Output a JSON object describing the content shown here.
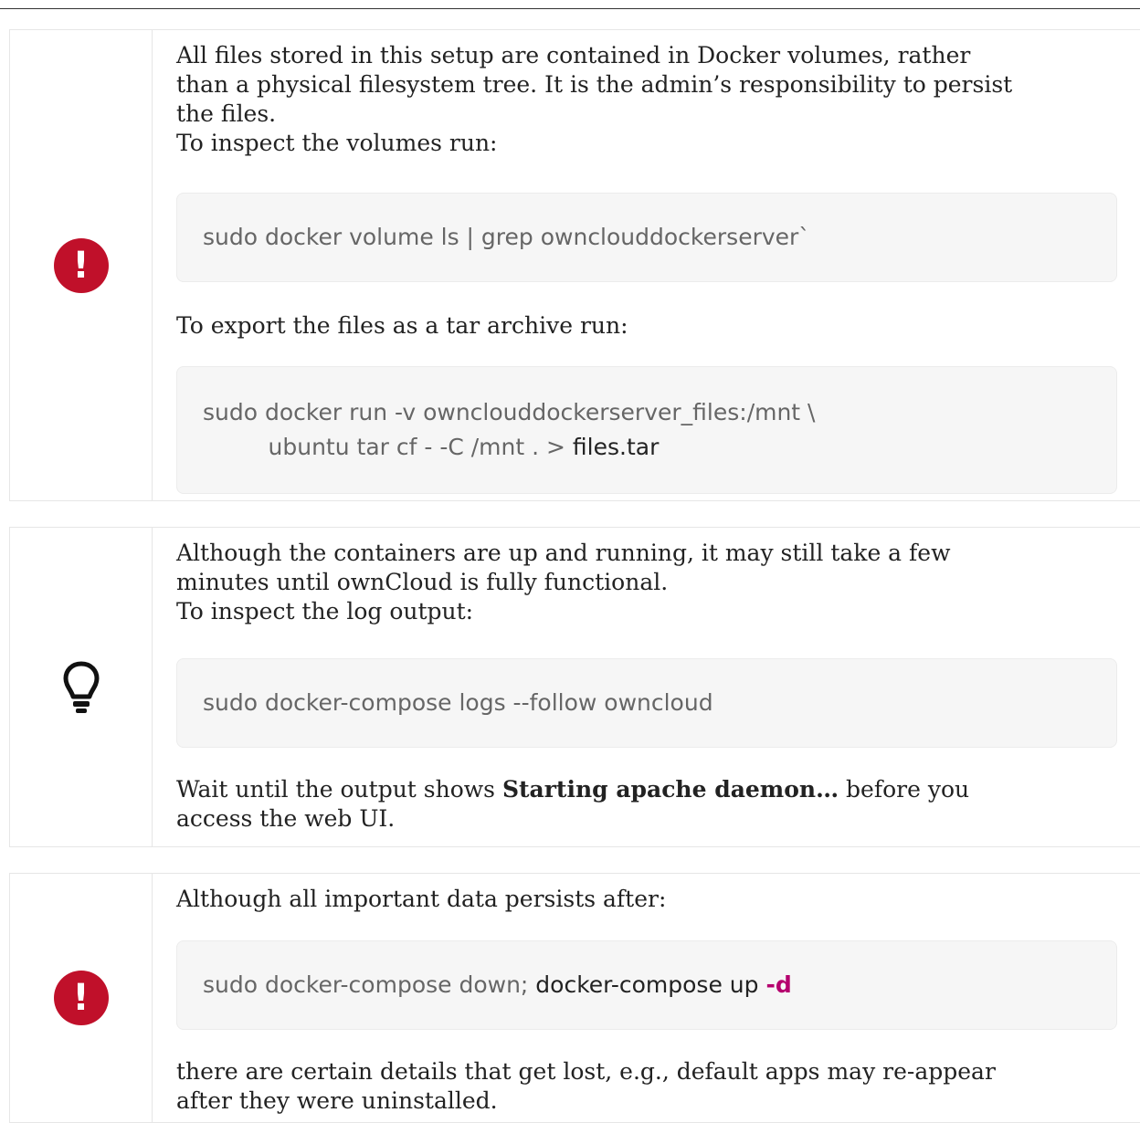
{
  "admonitions": [
    {
      "type": "important",
      "icon": "exclamation-circle-icon",
      "icon_color": "#c0102a",
      "icon_glyph": "!",
      "paragraph_1_lines": [
        "All files stored in this setup are contained in Docker volumes, rather",
        "than a physical filesystem tree. It is the admin’s responsibility to persist",
        "the files.",
        "To inspect the volumes run:"
      ],
      "code_1": "sudo docker volume ls | grep ownclouddockerserver`",
      "paragraph_2": "To export the files as a tar archive run:",
      "code_2_line_1": "sudo docker run -v ownclouddockerserver_files:/mnt \\",
      "code_2_line_2_indent": "         ubuntu tar cf - -C /mnt . > ",
      "code_2_line_2_emphasis": "files.tar"
    },
    {
      "type": "tip",
      "icon": "lightbulb-icon",
      "paragraph_1_lines": [
        "Although the containers are up and running, it may still take a few",
        "minutes until ownCloud is fully functional.",
        "To inspect the log output:"
      ],
      "code_1": "sudo docker-compose logs --follow owncloud",
      "paragraph_2_before": "Wait until the output shows ",
      "paragraph_2_bold": "Starting apache daemon…",
      "paragraph_2_after": " before you",
      "paragraph_2_line_2": "access the web UI."
    },
    {
      "type": "important",
      "icon": "exclamation-circle-icon",
      "icon_color": "#c0102a",
      "icon_glyph": "!",
      "paragraph_1": "Although all important data persists after:",
      "code_1_part_1": "sudo docker-compose down; ",
      "code_1_part_2": "docker-compose up ",
      "code_1_flag": "-d",
      "paragraph_2_lines": [
        "there are certain details that get lost, e.g., default apps may re-appear",
        "after they were uninstalled."
      ]
    }
  ]
}
